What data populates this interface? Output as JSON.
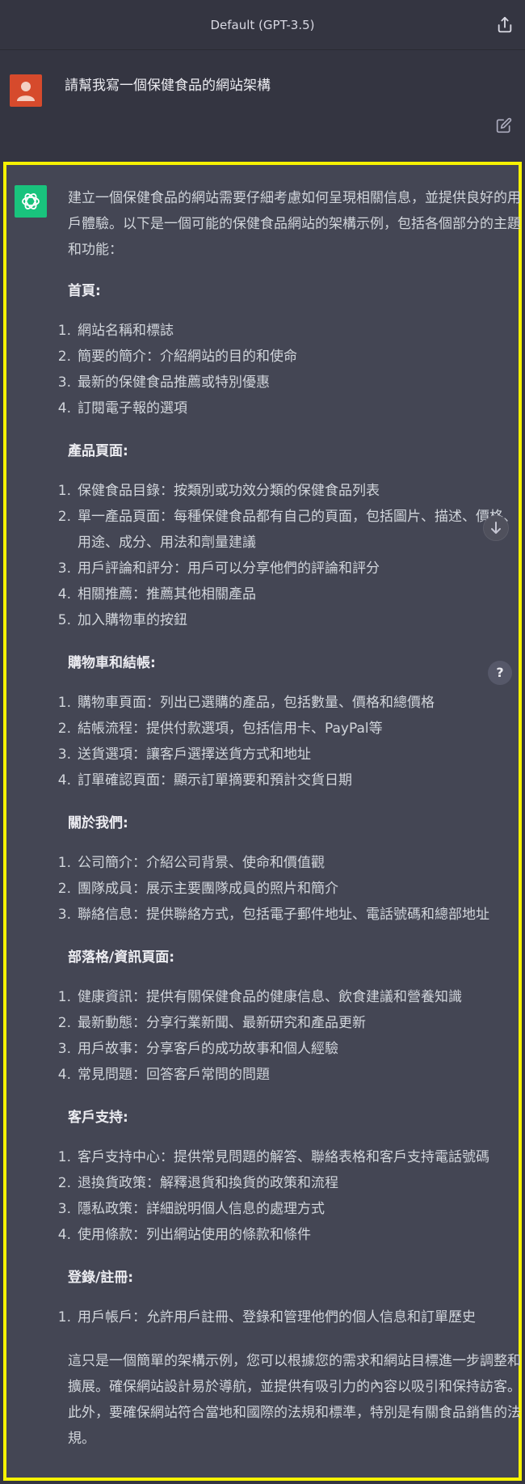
{
  "header": {
    "title": "Default (GPT-3.5)",
    "share_icon": "share-icon"
  },
  "user": {
    "message": "請幫我寫一個保健食品的網站架構",
    "avatar_color": "#d64a2c",
    "edit_icon": "edit-icon"
  },
  "assistant": {
    "avatar_color": "#19c37d",
    "intro": "建立一個保健食品的網站需要仔細考慮如何呈現相關信息，並提供良好的用戶體驗。以下是一個可能的保健食品網站的架構示例，包括各個部分的主題和功能：",
    "sections": [
      {
        "title": "首頁:",
        "items": [
          "網站名稱和標誌",
          "簡要的簡介：介紹網站的目的和使命",
          "最新的保健食品推薦或特別優惠",
          "訂閱電子報的選項"
        ]
      },
      {
        "title": "產品頁面:",
        "items": [
          "保健食品目錄：按類別或功效分類的保健食品列表",
          "單一產品頁面：每種保健食品都有自己的頁面，包括圖片、描述、價格、用途、成分、用法和劑量建議",
          "用戶評論和評分：用戶可以分享他們的評論和評分",
          "相關推薦：推薦其他相關產品",
          "加入購物車的按鈕"
        ]
      },
      {
        "title": "購物車和結帳:",
        "items": [
          "購物車頁面：列出已選購的產品，包括數量、價格和總價格",
          "結帳流程：提供付款選項，包括信用卡、PayPal等",
          "送貨選項：讓客戶選擇送貨方式和地址",
          "訂單確認頁面：顯示訂單摘要和預計交貨日期"
        ]
      },
      {
        "title": "關於我們:",
        "items": [
          "公司簡介：介紹公司背景、使命和價值觀",
          "團隊成員：展示主要團隊成員的照片和簡介",
          "聯絡信息：提供聯絡方式，包括電子郵件地址、電話號碼和總部地址"
        ]
      },
      {
        "title": "部落格/資訊頁面:",
        "items": [
          "健康資訊：提供有關保健食品的健康信息、飲食建議和營養知識",
          "最新動態：分享行業新聞、最新研究和產品更新",
          "用戶故事：分享客戶的成功故事和個人經驗",
          "常見問題：回答客戶常問的問題"
        ]
      },
      {
        "title": "客戶支持:",
        "items": [
          "客戶支持中心：提供常見問題的解答、聯絡表格和客戶支持電話號碼",
          "退換貨政策：解釋退貨和換貨的政策和流程",
          "隱私政策：詳細說明個人信息的處理方式",
          "使用條款：列出網站使用的條款和條件"
        ]
      },
      {
        "title": "登錄/註冊:",
        "items": [
          "用戶帳戶：允許用戶註冊、登錄和管理他們的個人信息和訂單歷史"
        ]
      }
    ],
    "outro": "這只是一個簡單的架構示例，您可以根據您的需求和網站目標進一步調整和擴展。確保網站設計易於導航，並提供有吸引力的內容以吸引和保持訪客。此外，要確保網站符合當地和國際的法規和標準，特別是有關食品銷售的法規。"
  },
  "floating": {
    "scroll_down_icon": "arrow-down-icon",
    "help_label": "?"
  },
  "highlight_color": "#f7f202"
}
